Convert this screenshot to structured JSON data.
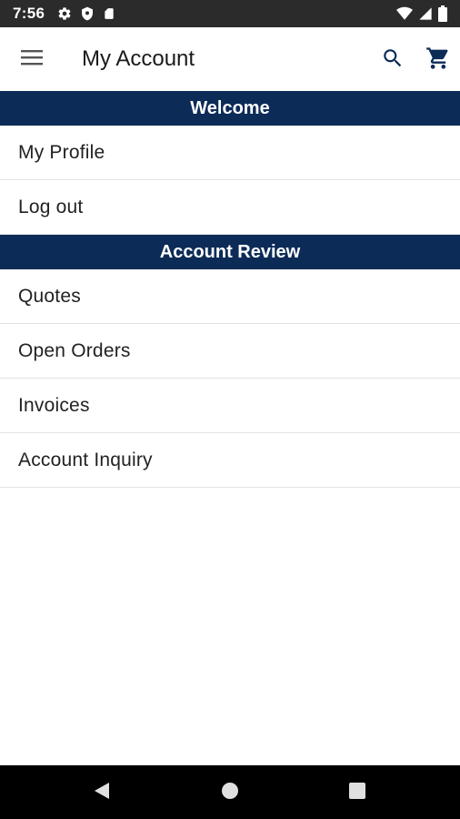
{
  "status_bar": {
    "time": "7:56",
    "icons": [
      "settings-icon",
      "shield-icon",
      "sd-card-icon",
      "wifi-icon",
      "signal-icon",
      "battery-icon"
    ]
  },
  "app_bar": {
    "title": "My Account",
    "icons": [
      "menu-icon",
      "search-icon",
      "cart-icon"
    ],
    "accent_color": "#0c2b57"
  },
  "sections": [
    {
      "header": "Welcome",
      "items": [
        "My Profile",
        "Log out"
      ]
    },
    {
      "header": "Account Review",
      "items": [
        "Quotes",
        "Open Orders",
        "Invoices",
        "Account Inquiry"
      ]
    }
  ],
  "nav_bar": {
    "icons": [
      "back-icon",
      "home-icon",
      "recents-icon"
    ]
  }
}
